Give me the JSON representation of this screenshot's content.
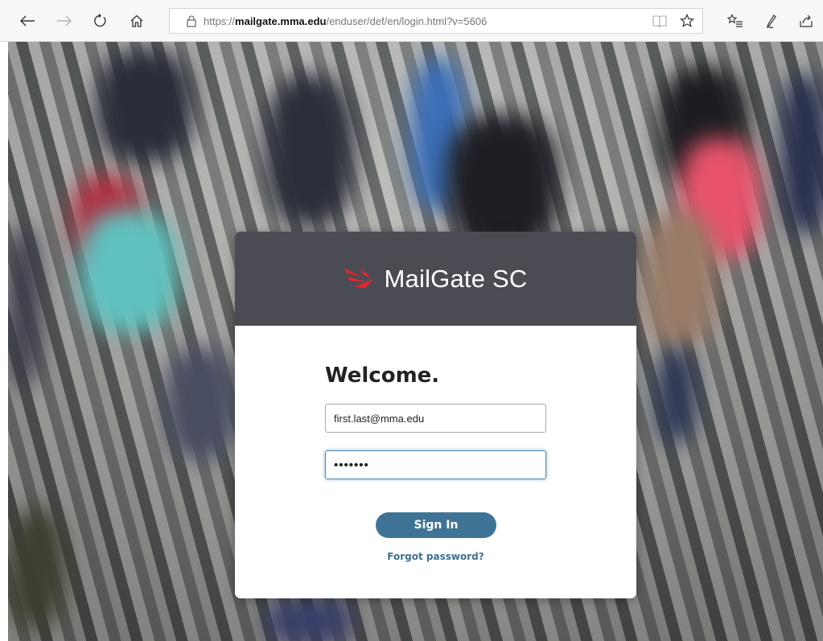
{
  "browser": {
    "url_prefix": "https://",
    "url_host": "mailgate.mma.edu",
    "url_path": "/enduser/def/en/login.html?v=5606",
    "icons": {
      "back": "back-arrow-icon",
      "forward": "forward-arrow-icon",
      "refresh": "refresh-icon",
      "home": "home-icon",
      "lock": "lock-icon",
      "reading_view": "reading-view-icon",
      "favorite": "star-icon",
      "favorites_list": "favorites-list-icon",
      "notes": "pen-icon",
      "share": "share-icon"
    }
  },
  "card": {
    "brand_name": "MailGate SC",
    "brand_color": "#e3262f",
    "welcome": "Welcome.",
    "email_value": "first.last@mma.edu",
    "password_masked": "•••••••",
    "sign_in_label": "Sign In",
    "forgot_label": "Forgot password?"
  },
  "colors": {
    "header_bg": "#4b4c53",
    "button_bg": "#3f7396",
    "link": "#3f6f8f"
  }
}
